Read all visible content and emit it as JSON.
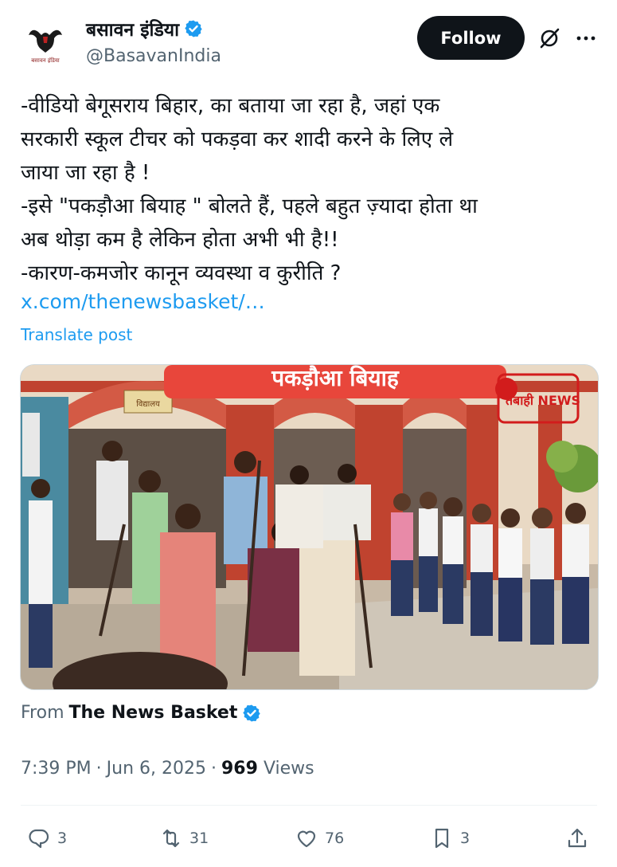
{
  "author": {
    "display_name": "बसावन इंडिया",
    "handle": "@BasavanIndia",
    "verified": true,
    "avatar_text": "बसावन इंडिया"
  },
  "header": {
    "follow_label": "Follow",
    "grok_icon": "slashed-circle-icon",
    "more_icon": "more-dots-icon"
  },
  "post": {
    "lines": [
      "-वीडियो बेगूसराय बिहार, का बताया जा रहा है, जहां एक",
      "सरकारी स्कूल टीचर को पकड़वा कर शादी करने के लिए ले",
      "जाया जा रहा है !",
      "-इसे \"पकड़ौआ बियाह \" बोलते हैं, पहले बहुत ज़्यादा होता था",
      "अब थोड़ा कम है लेकिन होता अभी भी है!!",
      "-कारण-कमजोर कानून व्यवस्था व कुरीति ?"
    ],
    "link": "x.com/thenewsbasket/…",
    "translate_label": "Translate post"
  },
  "media": {
    "banner_text": "पकड़ौआ बियाह",
    "watermark_text": "तबाही NEWS",
    "school_sign_text": "विद्यालय"
  },
  "source": {
    "from_label": "From",
    "name": "The News Basket",
    "verified": true
  },
  "meta": {
    "time": "7:39 PM",
    "separator": "·",
    "date": "Jun 6, 2025",
    "views_count": "969",
    "views_label": "Views"
  },
  "actions": {
    "reply_count": "3",
    "repost_count": "31",
    "like_count": "76",
    "bookmark_count": "3"
  },
  "colors": {
    "accent": "#1d9bf0",
    "text": "#0f1419",
    "muted": "#536471",
    "verified": "#1d9bf0"
  }
}
